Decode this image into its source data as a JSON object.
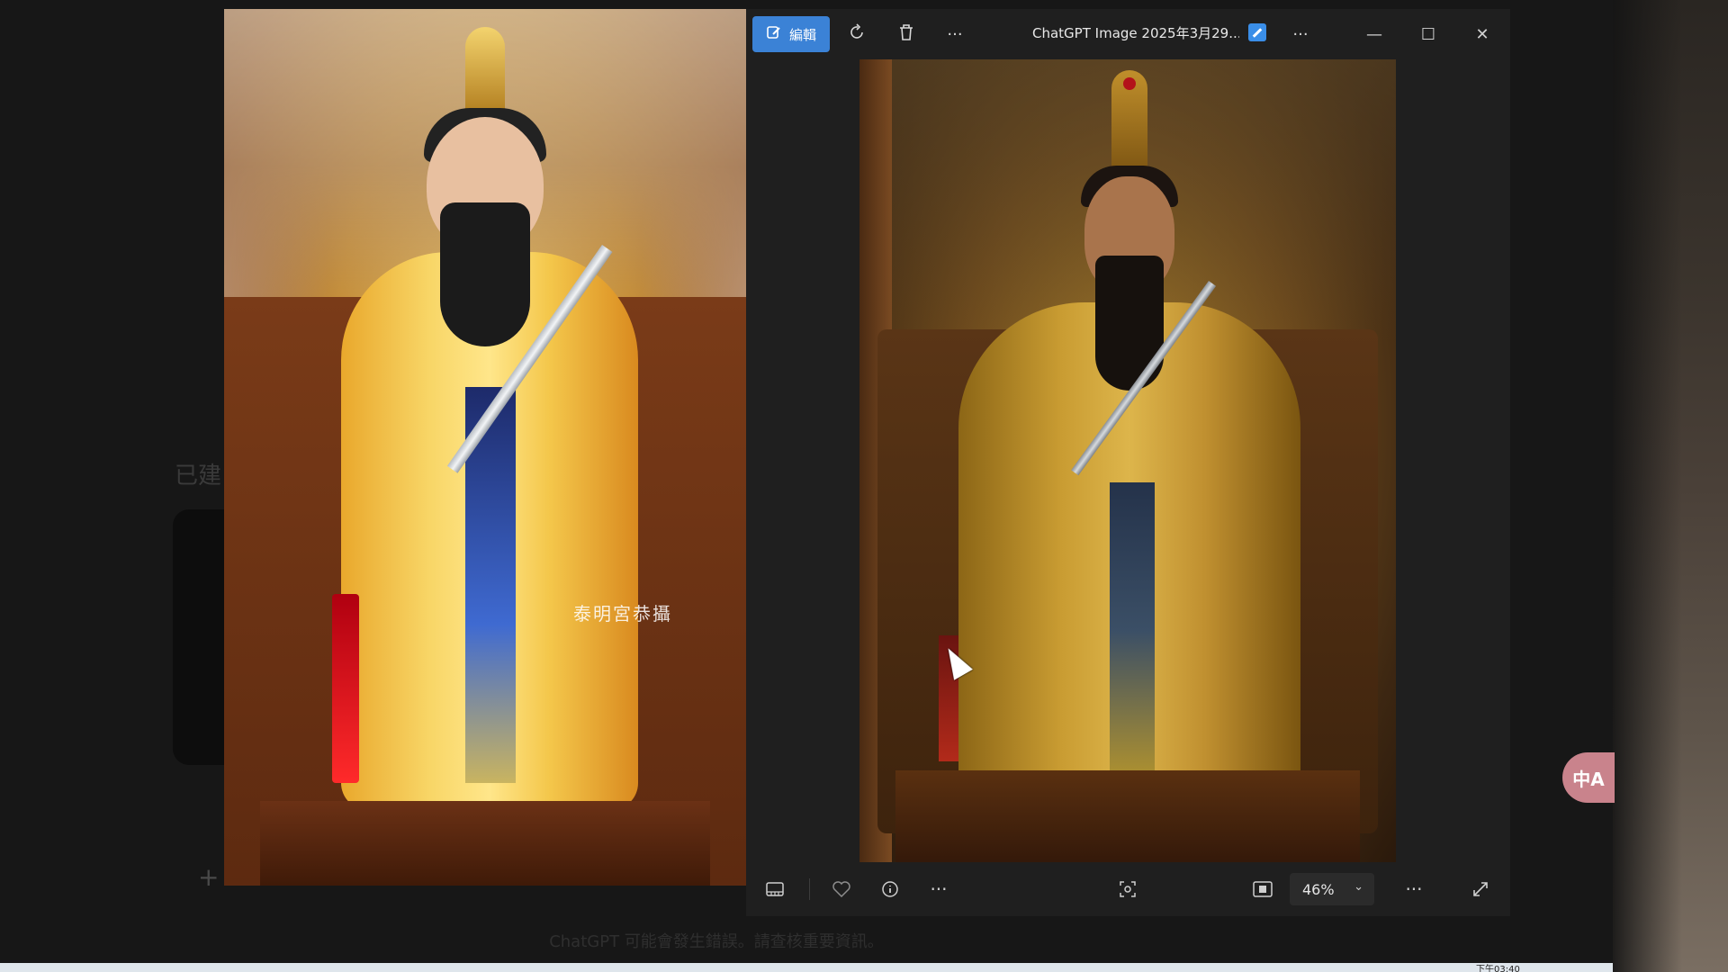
{
  "background_page": {
    "left_label": "已建",
    "disclaimer": "ChatGPT 可能會發生錯誤。請查核重要資訊。",
    "plus": "+"
  },
  "left_photo": {
    "watermark": "泰明宮恭攝"
  },
  "viewer": {
    "toolbar": {
      "edit_label": "編輯",
      "title": "ChatGPT Image 2025年3月29...",
      "more": "···"
    },
    "window_controls": {
      "minimize": "—",
      "maximize": "☐",
      "close": "✕"
    },
    "bottombar": {
      "zoom_value": "46%",
      "more": "···"
    }
  },
  "translate_button": {
    "label": "中A"
  },
  "taskbar": {
    "time": "下午03:40"
  },
  "colors": {
    "accent": "#3b82d6",
    "window_bg": "#1f1f1f",
    "translate_bg": "#c9838c"
  },
  "icons": [
    "edit-icon",
    "rotate-icon",
    "delete-icon",
    "more-icon",
    "ai-generated-icon",
    "minimize-icon",
    "maximize-icon",
    "close-icon",
    "filmstrip-icon",
    "favorite-icon",
    "info-icon",
    "face-scan-icon",
    "fit-screen-icon",
    "chevron-down-icon",
    "fullscreen-icon"
  ]
}
